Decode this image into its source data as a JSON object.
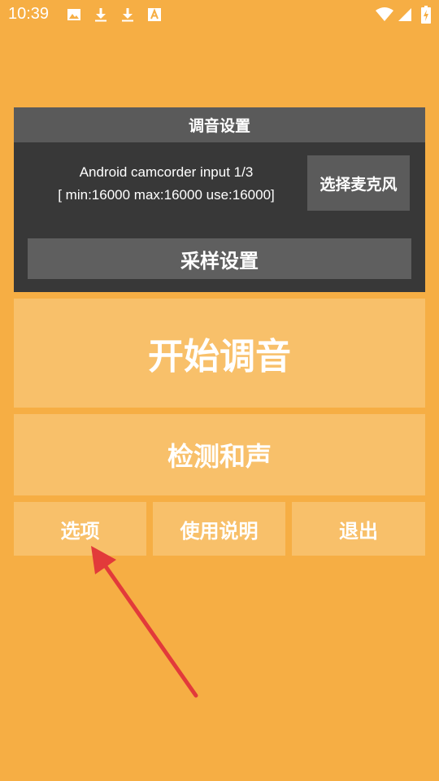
{
  "status_bar": {
    "time": "10:39",
    "left_icons": [
      "image-icon",
      "download-icon",
      "download-icon",
      "font-icon"
    ],
    "right_icons": [
      "wifi-icon",
      "signal-icon",
      "battery-charging-icon"
    ]
  },
  "tuning_panel": {
    "title": "调音设置",
    "mic_line1": "Android camcorder input 1/3",
    "mic_line2": "[ min:16000 max:16000 use:16000]",
    "select_mic_label": "选择麦克风",
    "sample_settings_label": "采样设置"
  },
  "main": {
    "start_tuning_label": "开始调音",
    "detect_chord_label": "检测和声",
    "options_label": "选项",
    "help_label": "使用说明",
    "exit_label": "退出"
  },
  "colors": {
    "background": "#f6ae44",
    "button": "#f8c06a",
    "panel": "#383838",
    "panel_header": "#5a5a5a",
    "annotation_arrow": "#e23a3a"
  }
}
